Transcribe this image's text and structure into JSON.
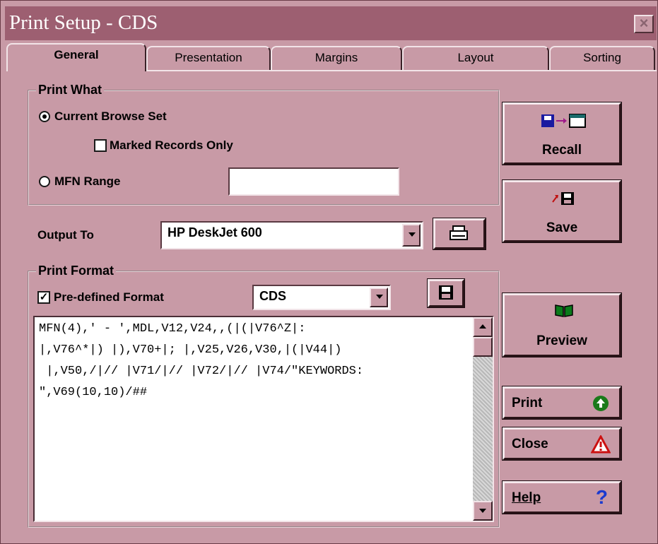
{
  "window": {
    "title": "Print Setup - CDS",
    "close_glyph": "×"
  },
  "tabs": [
    {
      "label": "General",
      "active": true
    },
    {
      "label": "Presentation"
    },
    {
      "label": "Margins"
    },
    {
      "label": "Layout"
    },
    {
      "label": "Sorting"
    }
  ],
  "print_what": {
    "title": "Print What",
    "current_browse_set": "Current Browse Set",
    "marked_records_only": "Marked Records Only",
    "mfn_range": "MFN Range",
    "mfn_range_value": "",
    "selected": "Current Browse Set",
    "marked_checked": false
  },
  "output": {
    "label": "Output To",
    "printer": "HP DeskJet 600"
  },
  "print_format": {
    "title": "Print Format",
    "predefined_label": "Pre-defined Format",
    "predefined_checked": true,
    "format_name": "CDS",
    "format_lines": [
      "MFN(4),' - ',MDL,V12,V24,,(|(|V76^Z|:",
      "|,V76^*|) |),V70+|; |,V25,V26,V30,|(|V44|)",
      " |,V50,/|// |V71/|// |V72/|// |V74/\"KEYWORDS:",
      "\",V69(10,10)/##"
    ]
  },
  "buttons": {
    "recall": "Recall",
    "save": "Save",
    "preview": "Preview",
    "print": "Print",
    "close": "Close",
    "help": "Help"
  },
  "colors": {
    "background": "#c89aa6",
    "titlebar": "#9d5f71",
    "print_icon": "#1a7a1a",
    "close_icon": "#cc1010",
    "help_icon": "#1a3ad0"
  }
}
